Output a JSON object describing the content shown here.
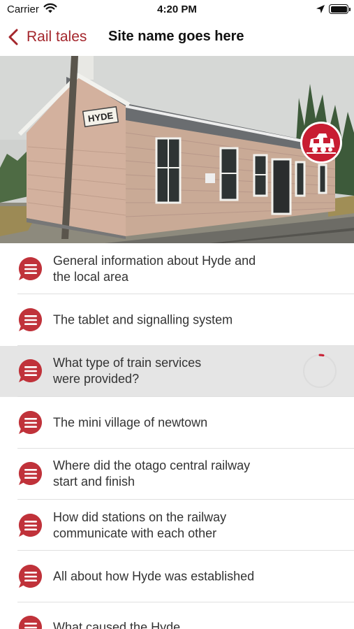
{
  "status_bar": {
    "carrier": "Carrier",
    "time": "4:20 PM",
    "icons": [
      "wifi-icon",
      "location-arrow-icon",
      "battery-icon"
    ]
  },
  "nav": {
    "back_label": "Rail tales",
    "title": "Site name goes here"
  },
  "hero": {
    "sign_text": "HYDE"
  },
  "colors": {
    "accent": "#a4262c",
    "icon_red": "#c0323a",
    "selected_row": "#e5e5e5"
  },
  "topics": [
    {
      "label": "General information about Hyde and\nthe local area",
      "icon": "chat-bubble-icon"
    },
    {
      "label": "The tablet and signalling system",
      "icon": "chat-bubble-icon"
    },
    {
      "label": "What type of train services\nwere provided?",
      "icon": "chat-bubble-icon",
      "selected": true,
      "loading": true
    },
    {
      "label": "The mini village of newtown",
      "icon": "chat-bubble-icon"
    },
    {
      "label": "Where did the otago central railway\nstart and finish",
      "icon": "chat-bubble-icon"
    },
    {
      "label": "How did stations on the railway\ncommunicate with each other",
      "icon": "chat-bubble-icon"
    },
    {
      "label": "All about how Hyde was established",
      "icon": "chat-bubble-icon"
    },
    {
      "label": "What caused the Hyde",
      "icon": "chat-bubble-icon"
    }
  ]
}
